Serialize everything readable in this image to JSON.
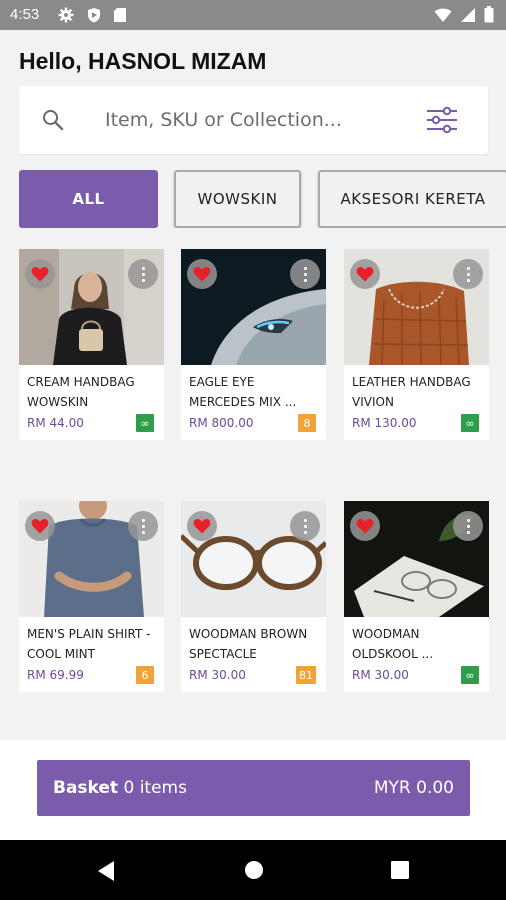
{
  "status_bar": {
    "time": "4:53",
    "left_icons": [
      "gear-icon",
      "shield-icon",
      "sdcard-icon"
    ],
    "right_icons": [
      "wifi-icon",
      "signal-icon",
      "battery-icon"
    ]
  },
  "greeting": "Hello, HASNOL MIZAM",
  "search": {
    "placeholder": "Item, SKU or Collection...",
    "value": ""
  },
  "categories": [
    {
      "label": "ALL",
      "active": true
    },
    {
      "label": "WOWSKIN",
      "active": false
    },
    {
      "label": "AKSESORI KERETA",
      "active": false
    }
  ],
  "products": [
    {
      "name": "CREAM HANDBAG WOWSKIN",
      "price": "RM 44.00",
      "badge": "∞",
      "badge_color": "green",
      "image": "woman-with-handbag"
    },
    {
      "name": "EAGLE EYE MERCEDES MIX ...",
      "price": "RM 800.00",
      "badge": "8",
      "badge_color": "orange",
      "image": "car-headlight"
    },
    {
      "name": "LEATHER HANDBAG VIVION",
      "price": "RM 130.00",
      "badge": "∞",
      "badge_color": "green",
      "image": "leather-bag"
    },
    {
      "name": "MEN'S PLAIN SHIRT - COOL MINT",
      "price": "RM 69.99",
      "badge": "6",
      "badge_color": "orange",
      "image": "man-in-shirt"
    },
    {
      "name": "WOODMAN BROWN SPECTACLE",
      "price": "RM 30.00",
      "badge": "81",
      "badge_color": "orange",
      "image": "spectacles"
    },
    {
      "name": "WOODMAN OLDSKOOL ...",
      "price": "RM 30.00",
      "badge": "∞",
      "badge_color": "green",
      "image": "glasses-on-notebook"
    }
  ],
  "basket": {
    "label": "Basket",
    "count_text": "0 items",
    "total": "MYR 0.00"
  },
  "colors": {
    "accent": "#7b5bab",
    "green_badge": "#2e9e4a",
    "orange_badge": "#f3a23a",
    "heart": "#e8202a"
  }
}
